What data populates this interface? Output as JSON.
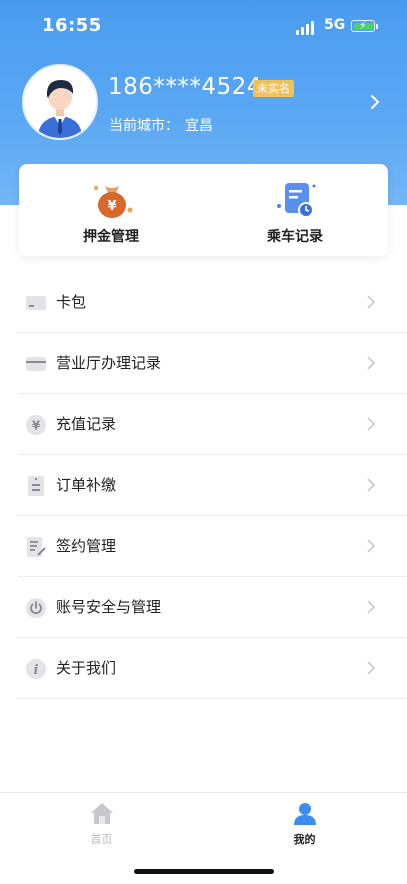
{
  "status_bar": {
    "time": "16:55",
    "network": "5G"
  },
  "profile": {
    "phone": "186****4524",
    "badge": "未实名",
    "city_label": "当前城市：",
    "city": "宜昌"
  },
  "quick_actions": [
    {
      "label": "押金管理",
      "icon": "money-bag-icon"
    },
    {
      "label": "乘车记录",
      "icon": "ride-record-icon"
    }
  ],
  "menu": [
    {
      "label": "卡包",
      "icon": "card-icon"
    },
    {
      "label": "营业厅办理记录",
      "icon": "service-hall-icon"
    },
    {
      "label": "充值记录",
      "icon": "yuan-icon"
    },
    {
      "label": "订单补缴",
      "icon": "order-icon"
    },
    {
      "label": "签约管理",
      "icon": "sign-icon"
    },
    {
      "label": "账号安全与管理",
      "icon": "power-icon"
    },
    {
      "label": "关于我们",
      "icon": "info-icon"
    }
  ],
  "tabbar": [
    {
      "label": "首页",
      "icon": "home-icon"
    },
    {
      "label": "我的",
      "icon": "profile-icon"
    }
  ],
  "colors": {
    "primary": "#4a9bf0",
    "badge": "#f0c25a",
    "active_tab": "#3d8df0",
    "inactive_tab": "#b9b9b9"
  }
}
